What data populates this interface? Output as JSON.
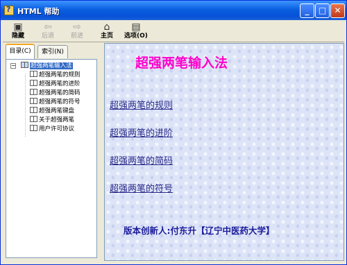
{
  "window": {
    "title": "HTML 帮助",
    "buttons": {
      "minimize": "_",
      "maximize": "□",
      "close": "✕"
    }
  },
  "toolbar": {
    "items": [
      {
        "label": "隐藏",
        "icon": "hide-icon",
        "enabled": true
      },
      {
        "label": "后退",
        "icon": "back-arrow-icon",
        "enabled": false
      },
      {
        "label": "前进",
        "icon": "forward-arrow-icon",
        "enabled": false
      },
      {
        "label": "主页",
        "icon": "home-icon",
        "enabled": true
      },
      {
        "label": "选项(O)",
        "icon": "options-icon",
        "enabled": true
      }
    ]
  },
  "nav": {
    "tabs": [
      {
        "label": "目录(C)",
        "active": true
      },
      {
        "label": "索引(N)",
        "active": false
      }
    ],
    "tree": {
      "root": {
        "label": "超强两笔输入法",
        "expanded": true,
        "selected": true
      },
      "children": [
        {
          "label": "超强两笔的规则"
        },
        {
          "label": "超强两笔的进阶"
        },
        {
          "label": "超强两笔的简码"
        },
        {
          "label": "超强两笔的符号"
        },
        {
          "label": "超强两笔键盘"
        },
        {
          "label": "关于超强两笔"
        },
        {
          "label": "用户许可协议"
        }
      ]
    }
  },
  "content": {
    "title": "超强两笔输入法",
    "links": [
      "超强两笔的规则",
      "超强两笔的进阶",
      "超强两笔的简码",
      "超强两笔的符号"
    ],
    "author": "版本创新人:付东升【辽宁中医药大学】"
  },
  "colors": {
    "title_pink": "#ff00cc",
    "link_color": "#2a2a8a",
    "author_color": "#1a1a9a",
    "titlebar_blue": "#0a5fe0"
  }
}
